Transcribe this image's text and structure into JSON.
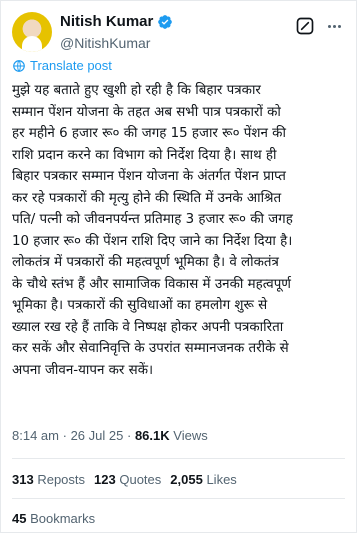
{
  "author": {
    "display_name": "Nitish Kumar",
    "handle": "@NitishKumar",
    "verified_badge_color": "#1d9bf0",
    "avatar_icon": "profile-photo"
  },
  "translate_label": "Translate post",
  "tweet_text": "मुझे यह बताते हुए खुशी हो रही है कि बिहार पत्रकार\nसम्मान पेंशन योजना के तहत अब सभी पात्र पत्रकारों को\nहर महीने 6 हजार रू० की जगह 15 हजार रू० पेंशन की\nराशि प्रदान करने का विभाग को निर्देश दिया है। साथ ही\nबिहार पत्रकार सम्मान पेंशन योजना के अंतर्गत पेंशन प्राप्त\nकर रहे पत्रकारों की मृत्यु होने की स्थिति में उनके आश्रित\nपति/ पत्नी को जीवनपर्यन्त प्रतिमाह 3 हजार रू० की जगह\n10 हजार रू० की पेंशन राशि दिए जाने का निर्देश दिया है।\nलोकतंत्र में पत्रकारों की महत्वपूर्ण भूमिका है। वे लोकतंत्र\nके चौथे स्तंभ हैं और सामाजिक विकास में उनकी महत्वपूर्ण\nभूमिका है। पत्रकारों की सुविधाओं का हमलोग शुरू से\nख्याल रख रहे हैं ताकि वे निष्पक्ष होकर अपनी पत्रकारिता\nकर सकें और सेवानिवृत्ति के उपरांत सम्मानजनक तरीके से\nअपना जीवन-यापन कर सकें।",
  "meta": {
    "time": "8:14 am",
    "separator": "·",
    "date": "26 Jul 25",
    "views_count": "86.1K",
    "views_label": "Views"
  },
  "stats": {
    "reposts_count": "313",
    "reposts_label": "Reposts",
    "quotes_count": "123",
    "quotes_label": "Quotes",
    "likes_count": "2,055",
    "likes_label": "Likes"
  },
  "bookmarks": {
    "count": "45",
    "label": "Bookmarks"
  }
}
